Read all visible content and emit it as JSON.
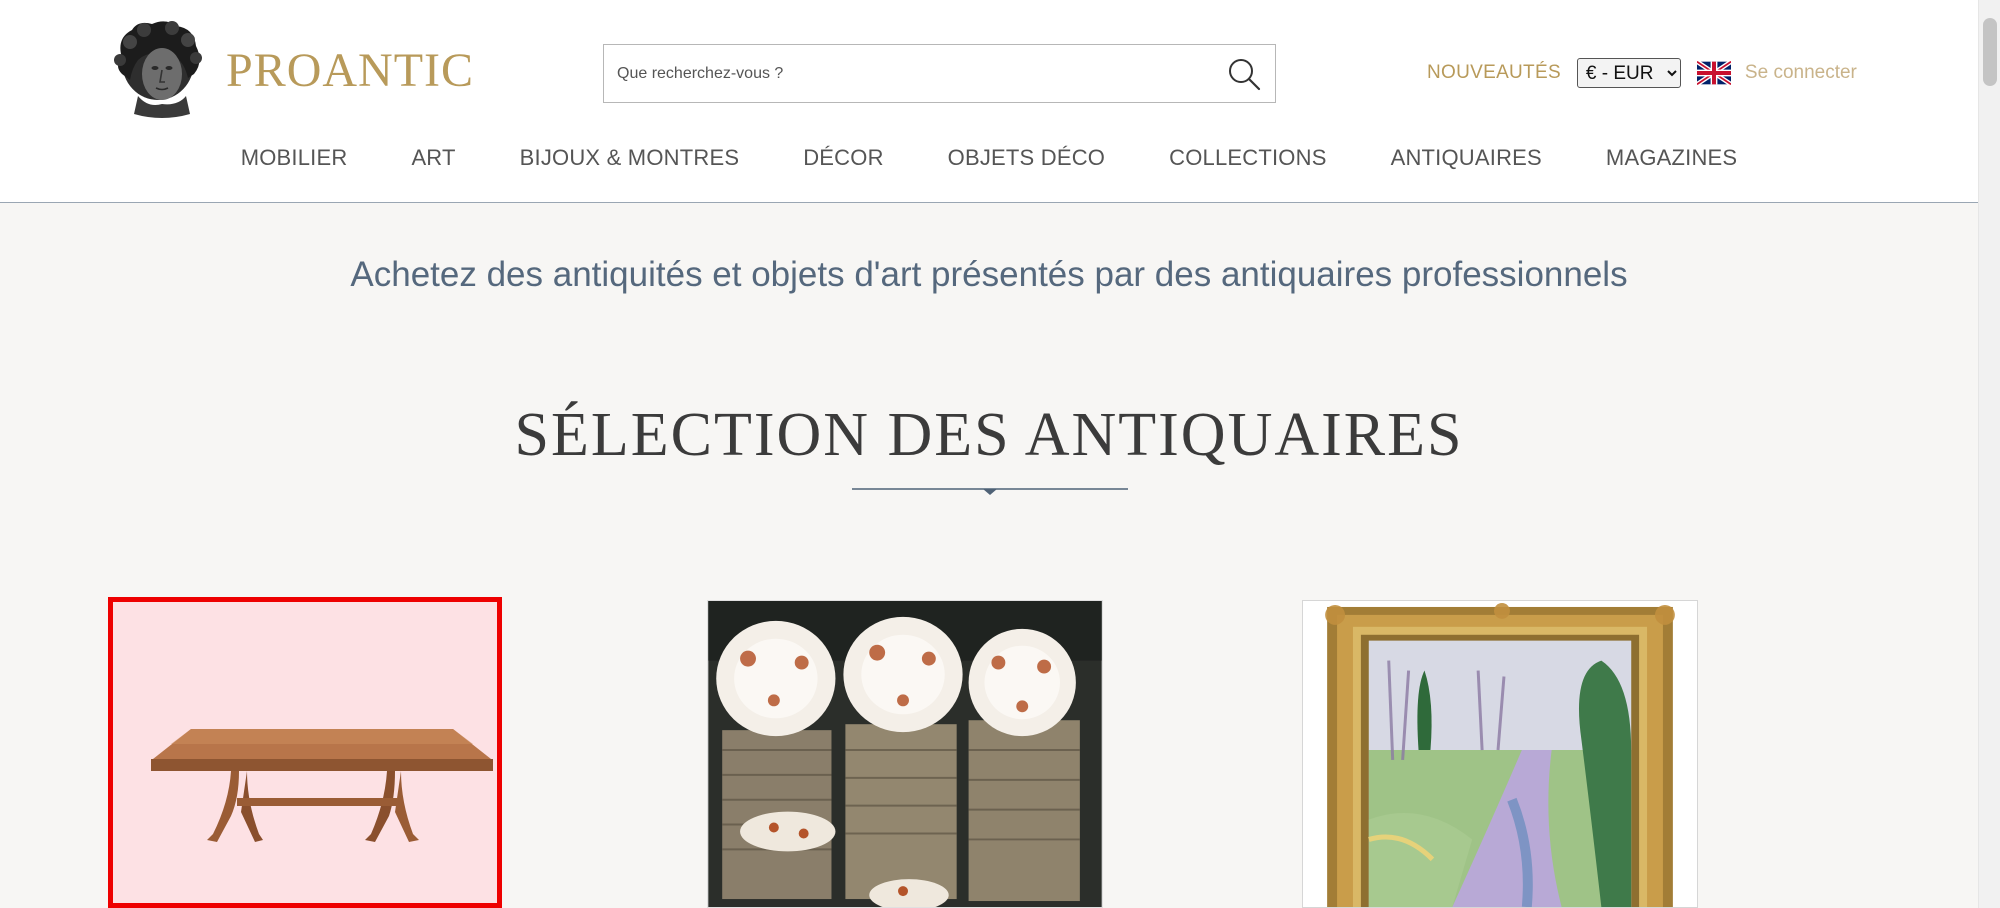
{
  "brand": {
    "name": "PROANTIC",
    "color": "#b89a5a"
  },
  "search": {
    "placeholder": "Que recherchez-vous ?",
    "value": ""
  },
  "header_links": {
    "new_label": "NOUVEAUTÉS",
    "currency_selected": "€ - EUR",
    "currency_options": [
      "€ - EUR"
    ],
    "language_flag": "uk-flag-icon",
    "login_label": "Se connecter"
  },
  "nav": {
    "items": [
      {
        "label": "MOBILIER"
      },
      {
        "label": "ART"
      },
      {
        "label": "BIJOUX & MONTRES"
      },
      {
        "label": "DÉCOR"
      },
      {
        "label": "OBJETS DÉCO"
      },
      {
        "label": "COLLECTIONS"
      },
      {
        "label": "ANTIQUAIRES"
      },
      {
        "label": "MAGAZINES"
      }
    ]
  },
  "main": {
    "tagline": "Achetez des antiquités et objets d'art présentés par des antiquaires professionnels",
    "section_title": "SÉLECTION DES ANTIQUAIRES",
    "products": [
      {
        "image": "dining-table-image",
        "highlighted": true
      },
      {
        "image": "porcelain-plates-image",
        "highlighted": false
      },
      {
        "image": "framed-landscape-painting-image",
        "highlighted": false
      }
    ]
  },
  "colors": {
    "accent_gold": "#b89a5a",
    "tagline_blue": "#55687d",
    "highlight_red": "#ee0000"
  }
}
